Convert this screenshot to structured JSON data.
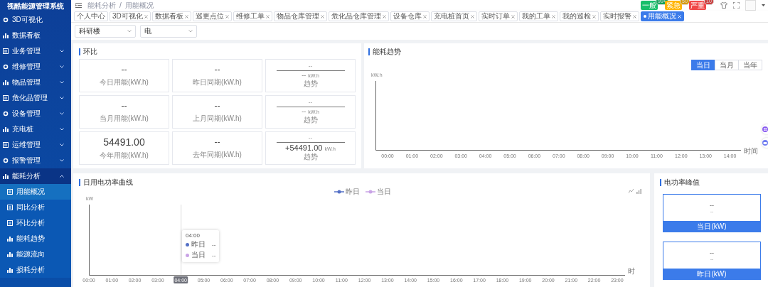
{
  "sidebar": {
    "title": "视酷能源管理系统",
    "items": [
      {
        "label": "3D可视化",
        "kind": "link"
      },
      {
        "label": "数据看板",
        "kind": "link"
      },
      {
        "label": "业务管理",
        "kind": "group",
        "expanded": false
      },
      {
        "label": "维修管理",
        "kind": "group",
        "expanded": false
      },
      {
        "label": "物品管理",
        "kind": "group",
        "expanded": false
      },
      {
        "label": "危化品管理",
        "kind": "group",
        "expanded": false
      },
      {
        "label": "设备管理",
        "kind": "group",
        "expanded": false
      },
      {
        "label": "充电桩",
        "kind": "group",
        "expanded": false
      },
      {
        "label": "运维管理",
        "kind": "group",
        "expanded": false
      },
      {
        "label": "报警管理",
        "kind": "group",
        "expanded": false
      },
      {
        "label": "能耗分析",
        "kind": "group",
        "expanded": true,
        "children": [
          {
            "label": "用能概况",
            "selected": true
          },
          {
            "label": "同比分析",
            "selected": false
          },
          {
            "label": "环比分析",
            "selected": false
          },
          {
            "label": "能耗趋势",
            "selected": false
          },
          {
            "label": "能源流向",
            "selected": false
          },
          {
            "label": "损耗分析",
            "selected": false
          }
        ]
      }
    ]
  },
  "header": {
    "breadcrumb": [
      "能耗分析",
      "用能概况"
    ],
    "breadcrumb_separator": "/",
    "alerts": [
      {
        "label": "一般",
        "count": "99+",
        "color": "#19be6b"
      },
      {
        "label": "紧急",
        "count": "50",
        "color": "#ffb400"
      },
      {
        "label": "严重",
        "count": "10",
        "color": "#f04848"
      }
    ]
  },
  "tabs": [
    {
      "label": "个人中心",
      "selected": false,
      "closable": false
    },
    {
      "label": "3D可视化",
      "selected": false,
      "closable": true
    },
    {
      "label": "数据看板",
      "selected": false,
      "closable": true
    },
    {
      "label": "巡更点位",
      "selected": false,
      "closable": true
    },
    {
      "label": "维修工单",
      "selected": false,
      "closable": true
    },
    {
      "label": "物品仓库管理",
      "selected": false,
      "closable": true
    },
    {
      "label": "危化品仓库管理",
      "selected": false,
      "closable": true
    },
    {
      "label": "设备仓库",
      "selected": false,
      "closable": true
    },
    {
      "label": "充电桩首页",
      "selected": false,
      "closable": true
    },
    {
      "label": "实时订单",
      "selected": false,
      "closable": true
    },
    {
      "label": "我的工单",
      "selected": false,
      "closable": true
    },
    {
      "label": "我的巡检",
      "selected": false,
      "closable": true
    },
    {
      "label": "实时报警",
      "selected": false,
      "closable": true
    },
    {
      "label": "用能概况",
      "selected": true,
      "closable": true
    }
  ],
  "filters": [
    {
      "value": "科研楼"
    },
    {
      "value": "电"
    }
  ],
  "comparison": {
    "title": "环比",
    "cells": [
      {
        "kind": "stat",
        "value": "--",
        "label": "今日用能(kW.h)"
      },
      {
        "kind": "stat",
        "value": "--",
        "label": "昨日同期(kW.h)"
      },
      {
        "kind": "trend",
        "top": "--",
        "value": "--",
        "unit": "kW.h",
        "label": "趋势"
      },
      {
        "kind": "stat",
        "value": "--",
        "label": "当月用能(kW.h)"
      },
      {
        "kind": "stat",
        "value": "--",
        "label": "上月同期(kW.h)"
      },
      {
        "kind": "trend",
        "top": "--",
        "value": "--",
        "unit": "kW.h",
        "label": "趋势"
      },
      {
        "kind": "stat",
        "value": "54491.00",
        "label": "今年用能(kW.h)"
      },
      {
        "kind": "stat",
        "value": "--",
        "label": "去年同期(kW.h)"
      },
      {
        "kind": "trend",
        "top": "--",
        "value": "+54491.00",
        "unit": "kW.h",
        "label": "趋势"
      }
    ]
  },
  "energy_trend": {
    "title": "能耗趋势",
    "ranges": [
      {
        "label": "当日",
        "selected": true
      },
      {
        "label": "当月",
        "selected": false
      },
      {
        "label": "当年",
        "selected": false
      }
    ],
    "y_unit": "kW.h",
    "x_name": "时间",
    "x_labels": [
      "00:00",
      "01:00",
      "02:00",
      "03:00",
      "04:00",
      "05:00",
      "06:00",
      "07:00",
      "08:00",
      "09:00",
      "10:00",
      "11:00",
      "12:00",
      "13:00",
      "14:00"
    ]
  },
  "power_curve": {
    "title": "日用电功率曲线",
    "y_unit": "kW",
    "x_name": "时",
    "legend": [
      {
        "label": "昨日",
        "color": "#5470c6"
      },
      {
        "label": "当日",
        "color": "#c9a3e6"
      }
    ],
    "x_labels": [
      {
        "label": "00:00",
        "highlighted": false
      },
      {
        "label": "01:00",
        "highlighted": false
      },
      {
        "label": "02:00",
        "highlighted": false
      },
      {
        "label": "03:00",
        "highlighted": false
      },
      {
        "label": "04:00",
        "highlighted": true
      },
      {
        "label": "05:00",
        "highlighted": false
      },
      {
        "label": "06:00",
        "highlighted": false
      },
      {
        "label": "07:00",
        "highlighted": false
      },
      {
        "label": "08:00",
        "highlighted": false
      },
      {
        "label": "09:00",
        "highlighted": false
      },
      {
        "label": "10:00",
        "highlighted": false
      },
      {
        "label": "11:00",
        "highlighted": false
      },
      {
        "label": "12:00",
        "highlighted": false
      },
      {
        "label": "13:00",
        "highlighted": false
      },
      {
        "label": "14:00",
        "highlighted": false
      },
      {
        "label": "15:00",
        "highlighted": false
      },
      {
        "label": "16:00",
        "highlighted": false
      },
      {
        "label": "17:00",
        "highlighted": false
      },
      {
        "label": "18:00",
        "highlighted": false
      },
      {
        "label": "19:00",
        "highlighted": false
      },
      {
        "label": "20:00",
        "highlighted": false
      },
      {
        "label": "21:00",
        "highlighted": false
      },
      {
        "label": "22:00",
        "highlighted": false
      },
      {
        "label": "23:00",
        "highlighted": false
      }
    ],
    "tooltip": {
      "title": "04:00",
      "rows": [
        {
          "label": "昨日",
          "value": "--",
          "color": "#5470c6"
        },
        {
          "label": "当日",
          "value": "--",
          "color": "#c9a3e6"
        }
      ]
    }
  },
  "power_peaks": {
    "title": "电功率峰值",
    "cards": [
      {
        "value": "--",
        "sub": "--",
        "label": "当日(kW)"
      },
      {
        "value": "--",
        "sub": "--",
        "label": "昨日(kW)"
      }
    ]
  }
}
